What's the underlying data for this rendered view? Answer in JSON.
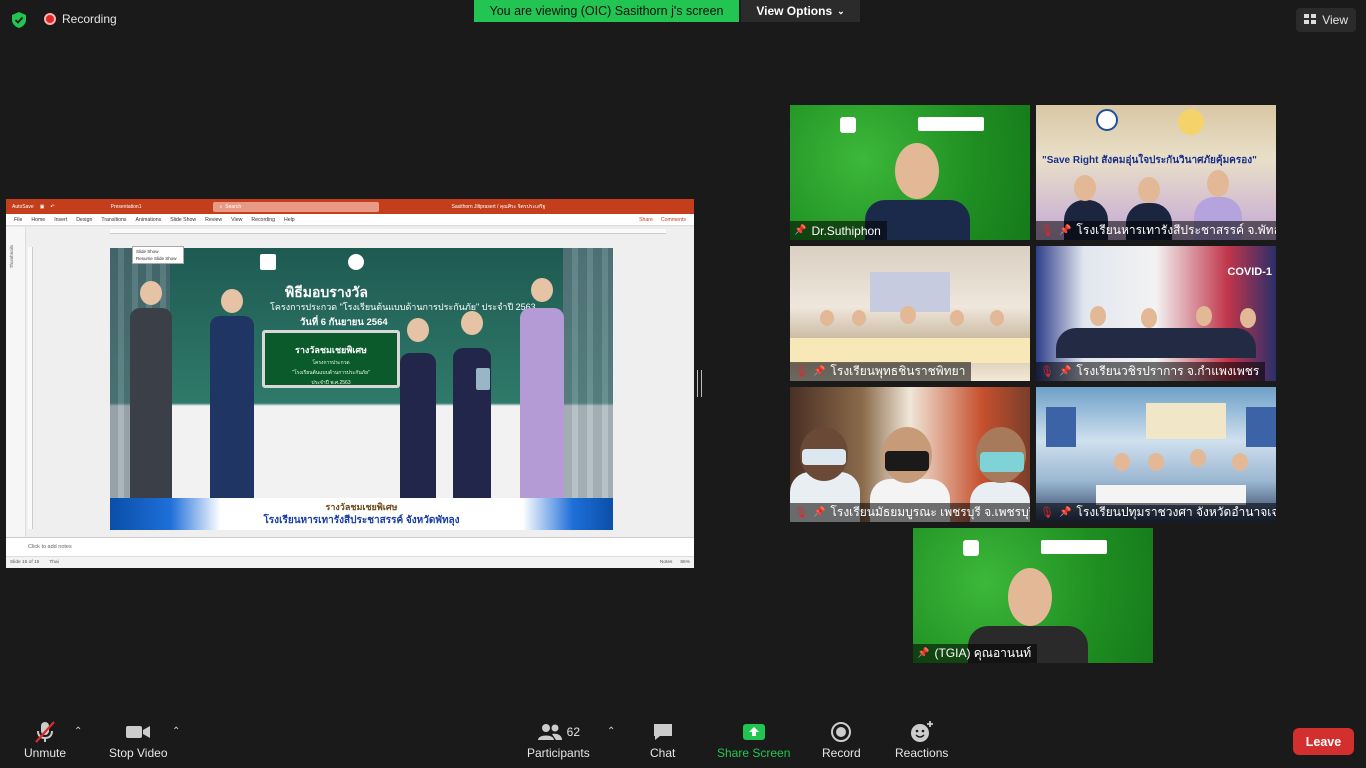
{
  "top_bar": {
    "recording_label": "Recording",
    "viewing_banner": "You are viewing (OIC) Sasithorn j's screen",
    "view_options_label": "View Options",
    "view_label": "View"
  },
  "shared_screen": {
    "app_title": "Presentation1",
    "autosave": "AutoSave",
    "search_placeholder": "Search",
    "user": "Sasithorn Jiltprasert / คุณศิระ จิตรประเสริฐ",
    "menu": [
      "File",
      "Home",
      "Insert",
      "Design",
      "Transitions",
      "Animations",
      "Slide Show",
      "Review",
      "View",
      "Recording",
      "Help"
    ],
    "share_label": "Share",
    "comments_label": "Comments",
    "thumbnails_label": "Thumbnails",
    "popup": [
      "Slide Show",
      "Resume Slide Show"
    ],
    "slide": {
      "heading": "พิธีมอบรางวัล",
      "subheading": "โครงการประกวด \"โรงเรียนต้นแบบด้านการประกันภัย\" ประจำปี 2563",
      "date": "วันที่ 6 กันยายน 2564",
      "award_title": "รางวัลชมเชยพิเศษ",
      "award_line1": "โครงการประกวด",
      "award_line2": "\"โรงเรียนต้นแบบด้านการประกันภัย\"",
      "award_line3": "ประจำปี พ.ศ.2563",
      "caption_award": "รางวัลชมเชยพิเศษ",
      "caption_school": "โรงเรียนหารเทารังสีประชาสรรค์ จังหวัดพัทลุง"
    },
    "notes_placeholder": "Click to add notes",
    "status_left": "Slide 15 of 15",
    "status_lang": "Thai",
    "status_notes": "Notes",
    "status_zoom": "86%"
  },
  "participants_tiles": [
    {
      "name": "Dr.Suthiphon",
      "muted": false
    },
    {
      "name": "โรงเรียนหารเทารังสีประชาสรรค์ จ.พัทลุง",
      "muted": true,
      "banner": "\"Save Right สังคมอุ่นใจประกันวินาศภัยคุ้มครอง\""
    },
    {
      "name": "โรงเรียนพุทธชินราชพิทยา",
      "muted": true
    },
    {
      "name": "โรงเรียนวชิรปราการ จ.กำแพงเพชร",
      "muted": true,
      "poster": "COVID-1"
    },
    {
      "name": "โรงเรียนมัธยมบูรณะ เพชรบุรี จ.เพชรบุรี",
      "muted": true
    },
    {
      "name": "โรงเรียนปทุมราชวงศา จังหวัดอำนาจเจ...",
      "muted": true
    },
    {
      "name": "(TGIA) คุณอานนท์",
      "muted": false
    }
  ],
  "toolbar": {
    "unmute": "Unmute",
    "stop_video": "Stop Video",
    "participants": "Participants",
    "participants_count": "62",
    "chat": "Chat",
    "share_screen": "Share Screen",
    "record": "Record",
    "reactions": "Reactions",
    "leave": "Leave"
  },
  "colors": {
    "banner_green": "#23c552",
    "leave_red": "#d32f2f",
    "ppt_orange": "#c43e1c"
  }
}
